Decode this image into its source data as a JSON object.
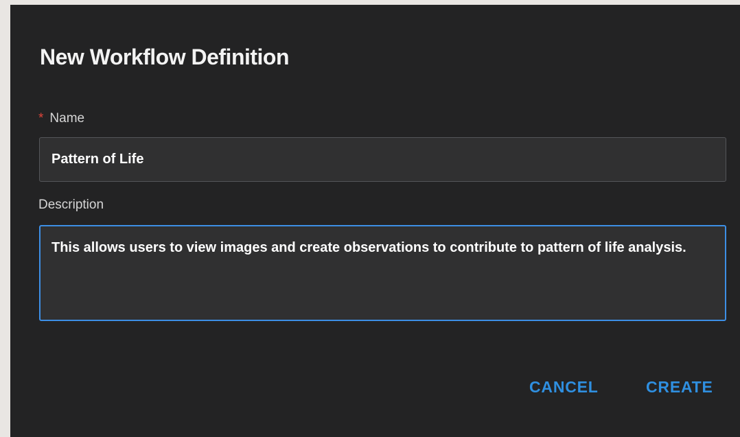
{
  "dialog": {
    "title": "New Workflow Definition",
    "name_field": {
      "required_marker": "*",
      "label": "Name",
      "value": "Pattern of Life"
    },
    "description_field": {
      "label": "Description",
      "value": "This allows users to view images and create observations to contribute to pattern of life analysis."
    },
    "actions": {
      "cancel_label": "CANCEL",
      "create_label": "CREATE"
    }
  },
  "colors": {
    "dialog_background": "#232324",
    "field_background": "#303031",
    "focus_border": "#3d8fe6",
    "accent": "#2f8fe0",
    "required": "#e0453a"
  }
}
